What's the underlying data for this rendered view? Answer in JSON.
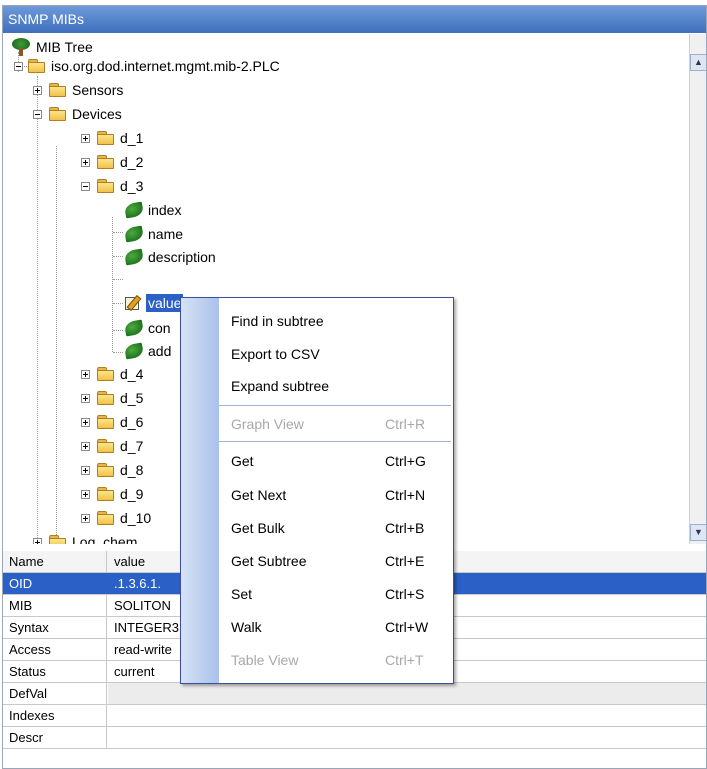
{
  "panel": {
    "title": "SNMP MIBs"
  },
  "tree": {
    "root": "MIB Tree",
    "branch": "iso.org.dod.internet.mgmt.mib-2.PLC",
    "sensors": "Sensors",
    "devices": "Devices",
    "d1": "d_1",
    "d2": "d_2",
    "d3": "d_3",
    "d3_children": [
      "index",
      "name",
      "description",
      "value",
      "con",
      "add"
    ],
    "d4": "d_4",
    "d5": "d_5",
    "d6": "d_6",
    "d7": "d_7",
    "d8": "d_8",
    "d9": "d_9",
    "d10": "d_10",
    "partial": "Log_chem"
  },
  "properties": {
    "header": {
      "name": "Name",
      "value": "value"
    },
    "rows": [
      {
        "name": "OID",
        "value": ".1.3.6.1."
      },
      {
        "name": "MIB",
        "value": "SOLITON"
      },
      {
        "name": "Syntax",
        "value": "INTEGER3"
      },
      {
        "name": "Access",
        "value": "read-write"
      },
      {
        "name": "Status",
        "value": "current"
      },
      {
        "name": "DefVal",
        "value": ""
      },
      {
        "name": "Indexes",
        "value": ""
      },
      {
        "name": "Descr",
        "value": ""
      }
    ]
  },
  "context_menu": {
    "find_in_subtree": "Find in subtree",
    "export_csv": "Export to CSV",
    "expand_subtree": "Expand subtree",
    "graph_view": {
      "label": "Graph View",
      "shortcut": "Ctrl+R"
    },
    "get": {
      "label": "Get",
      "shortcut": "Ctrl+G"
    },
    "get_next": {
      "label": "Get Next",
      "shortcut": "Ctrl+N"
    },
    "get_bulk": {
      "label": "Get Bulk",
      "shortcut": "Ctrl+B"
    },
    "get_subtree": {
      "label": "Get Subtree",
      "shortcut": "Ctrl+E"
    },
    "set": {
      "label": "Set",
      "shortcut": "Ctrl+S"
    },
    "walk": {
      "label": "Walk",
      "shortcut": "Ctrl+W"
    },
    "table_view": {
      "label": "Table View",
      "shortcut": "Ctrl+T"
    }
  },
  "colors": {
    "title_bar": "#3f6fbe",
    "selection": "#2b60c6",
    "menu_border": "#3b4fa0",
    "disabled_text": "#a8a8a8"
  }
}
